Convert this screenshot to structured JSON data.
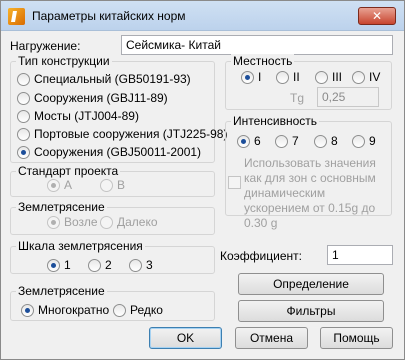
{
  "window": {
    "title": "Параметры китайских норм",
    "close_label": "✕"
  },
  "load": {
    "label": "Нагружение:",
    "value": "Сейсмика- Китай"
  },
  "construction_type": {
    "title": "Тип конструкции",
    "options": [
      "Специальный (GB50191-93)",
      "Сооружения (GBJ11-89)",
      "Мосты (JTJ004-89)",
      "Портовые сооружения (JTJ225-98)",
      "Сооружения (GBJ50011-2001)"
    ],
    "selected": 4
  },
  "project_standard": {
    "title": "Стандарт проекта",
    "options": [
      "A",
      "B"
    ],
    "selected": 0
  },
  "earthquake_distance": {
    "title": "Землетрясение",
    "options": [
      "Возле",
      "Далеко"
    ],
    "selected": 0
  },
  "scale": {
    "title": "Шкала землетрясения",
    "options": [
      "1",
      "2",
      "3"
    ],
    "selected": 0
  },
  "earthquake_freq": {
    "title": "Землетрясение",
    "options": [
      "Многократно",
      "Редко"
    ],
    "selected": 0
  },
  "terrain": {
    "title": "Местность",
    "options": [
      "I",
      "II",
      "III",
      "IV"
    ],
    "selected": 0,
    "tg_label": "Tg",
    "tg_value": "0,25"
  },
  "intensity": {
    "title": "Интенсивность",
    "options": [
      "6",
      "7",
      "8",
      "9"
    ],
    "selected": 0,
    "checkbox_label": "Использовать значения как для зон с основным динамическим ускорением от 0.15g до 0.30 g"
  },
  "coefficient": {
    "label": "Коэффициент:",
    "value": "1"
  },
  "buttons": {
    "direction": "Определение направления",
    "filters": "Фильтры",
    "ok": "OK",
    "cancel": "Отмена",
    "help": "Помощь"
  }
}
